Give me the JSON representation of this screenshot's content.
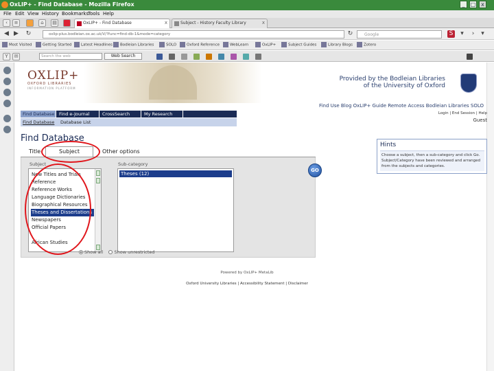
{
  "window": {
    "title": "OxLIP+ - Find Database - Mozilla Firefox",
    "min": "_",
    "max": "□",
    "close": "x"
  },
  "menu": [
    "File",
    "Edit",
    "View",
    "History",
    "Bookmarks",
    "Tools",
    "Help"
  ],
  "tabs": [
    {
      "label": "OxLIP+ - Find Database",
      "close": "x"
    },
    {
      "label": "Subject - History Faculty Library",
      "close": "x"
    }
  ],
  "nav": {
    "back": "◀",
    "forward": "▶",
    "url": "oxlip-plus.bodleian.ox.ac.uk/V/?func=find-db-1&mode=category",
    "search_placeholder": "Google"
  },
  "bookmarks": [
    "Most Visited",
    "Getting Started",
    "Latest Headlines",
    "Bodleian Libraries",
    "SOLO",
    "Oxford Reference",
    "WebLearn",
    "OxLIP+",
    "Subject Guides",
    "Library Blogs",
    "Zotero"
  ],
  "toolbar2": {
    "search_placeholder": "Search the web",
    "web_search_label": "Web Search"
  },
  "banner": {
    "logo": "OXLIP+",
    "subtitle1": "OXFORD LIBRARIES",
    "subtitle2": "INFORMATION PLATFORM",
    "provided_line1": "Provided by the Bodleian Libraries",
    "provided_line2": "of the University of Oxford"
  },
  "external_links": "Find  Use  Blog  OxLIP+ Guide  Remote Access  Bodleian Libraries  SOLO",
  "main_nav": [
    {
      "label": "Find Database",
      "active": true
    },
    {
      "label": "Find e-Journal",
      "active": false
    },
    {
      "label": "CrossSearch",
      "active": false
    },
    {
      "label": "My Research",
      "active": false
    }
  ],
  "sub_nav": {
    "item1": "Find Database",
    "item2": "Database List"
  },
  "user": {
    "links": "Login | End Session | Help",
    "name": "Guest"
  },
  "page_title": "Find Database",
  "find_tabs": {
    "title": "Title",
    "subject": "Subject",
    "other": "Other options"
  },
  "panel": {
    "subject_label": "Subject",
    "category_label": "Sub-category",
    "subjects": [
      {
        "label": "New Titles and Trials",
        "selected": false
      },
      {
        "label": "Reference",
        "selected": false
      },
      {
        "label": "Reference Works",
        "selected": false
      },
      {
        "label": "Language Dictionaries",
        "selected": false
      },
      {
        "label": "Biographical Resources",
        "selected": false
      },
      {
        "label": "Theses and Dissertations",
        "selected": true
      },
      {
        "label": "Newspapers",
        "selected": false
      },
      {
        "label": "Official Papers",
        "selected": false
      },
      {
        "label": "African Studies",
        "selected": false
      }
    ],
    "categories": [
      {
        "label": "Theses (12)",
        "selected": true
      }
    ],
    "go_label": "GO",
    "show_all": "Show all",
    "show_unrestricted": "Show unrestricted"
  },
  "hints": {
    "heading": "Hints",
    "body": "Choose a subject, then a sub-category and click Go. Subject/Category have been reviewed and arranged from the subjects and categories."
  },
  "footer": {
    "powered": "Powered by OxLIP+ MetaLib",
    "links": "Oxford University Libraries | Accessibility Statement | Disclaimer"
  },
  "colors": {
    "titlebar": "#3a8a3c",
    "nav_dark": "#1a2b55",
    "nav_active": "#8ca2cc",
    "selection": "#1c3d8c",
    "annotation": "#e0161c"
  }
}
